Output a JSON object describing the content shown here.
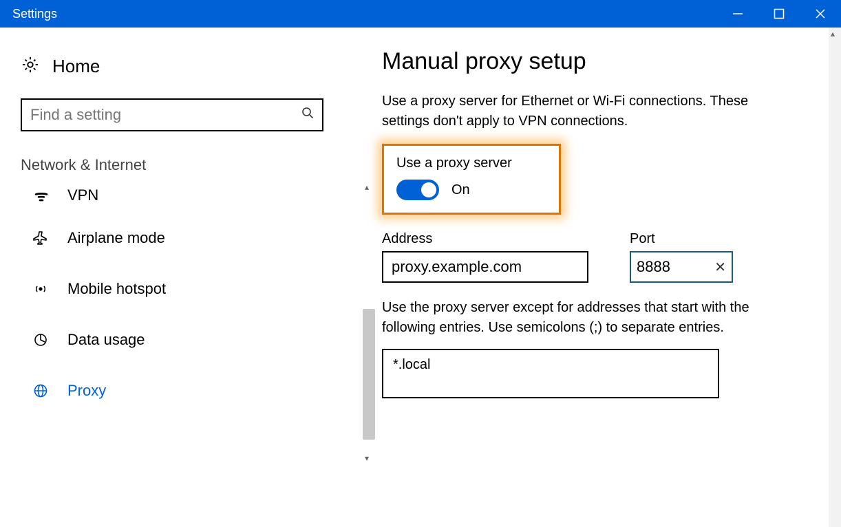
{
  "window": {
    "title": "Settings"
  },
  "sidebar": {
    "home_label": "Home",
    "search_placeholder": "Find a setting",
    "category": "Network & Internet",
    "items": [
      {
        "label": "VPN"
      },
      {
        "label": "Airplane mode"
      },
      {
        "label": "Mobile hotspot"
      },
      {
        "label": "Data usage"
      },
      {
        "label": "Proxy"
      }
    ]
  },
  "main": {
    "heading": "Manual proxy setup",
    "description": "Use a proxy server for Ethernet or Wi-Fi connections. These settings don't apply to VPN connections.",
    "use_proxy_label": "Use a proxy server",
    "toggle_state": "On",
    "address_label": "Address",
    "address_value": "proxy.example.com",
    "port_label": "Port",
    "port_value": "8888",
    "exceptions_desc": "Use the proxy server except for addresses that start with the following entries. Use semicolons (;) to separate entries.",
    "exceptions_value": "*.local"
  }
}
